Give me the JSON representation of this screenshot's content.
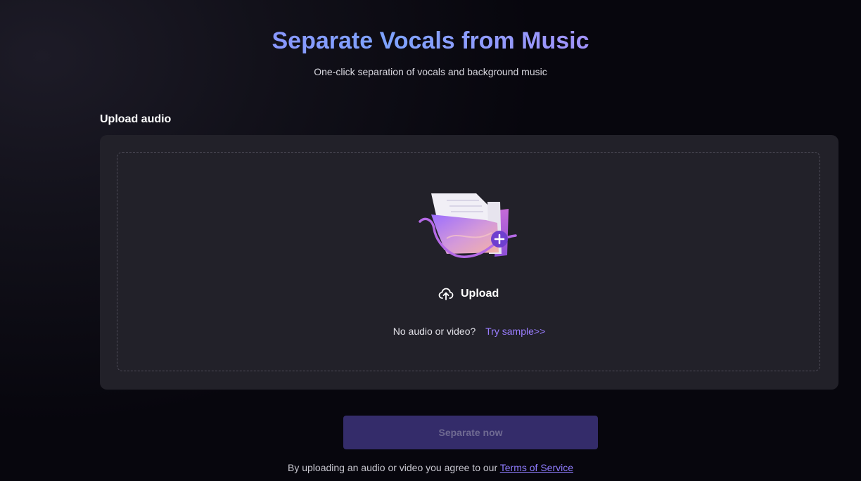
{
  "header": {
    "title": "Separate Vocals from Music",
    "subtitle": "One-click separation of vocals and background music"
  },
  "upload": {
    "section_label": "Upload audio",
    "button_label": "Upload",
    "button_icon": "cloud-upload-icon",
    "illustration_icon": "folder-plus-icon",
    "sample_question": "No audio or video?",
    "sample_link": "Try sample>>"
  },
  "action": {
    "separate_label": "Separate now"
  },
  "footer": {
    "agreement_text": "By uploading an audio or video you agree to our ",
    "terms_link": "Terms of Service"
  },
  "colors": {
    "background": "#07060d",
    "panel": "#222129",
    "accent": "#9a7dff",
    "button_disabled": "#342c6a",
    "title_gradient": [
      "#a47cff",
      "#7ea3ff",
      "#d27cf6"
    ]
  }
}
